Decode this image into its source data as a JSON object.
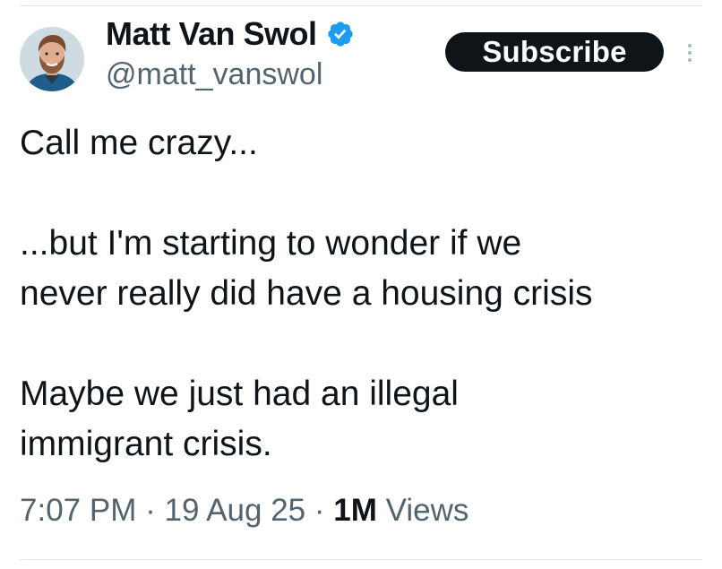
{
  "author": {
    "display_name": "Matt Van Swol",
    "handle": "@matt_vanswol",
    "verified": true,
    "verified_color": "#1d9bf0"
  },
  "header": {
    "subscribe_label": "Subscribe",
    "more_icon": "more-vertical-icon"
  },
  "tweet": {
    "line1": "Call me crazy...",
    "line2": "...but I'm starting to wonder if we",
    "line3": "never really did have a housing crisis",
    "line4": "Maybe we just had an illegal",
    "line5": "immigrant crisis."
  },
  "meta": {
    "time": "7:07 PM",
    "separator": "·",
    "date": "19 Aug 25",
    "views_count": "1M",
    "views_label": "Views"
  }
}
